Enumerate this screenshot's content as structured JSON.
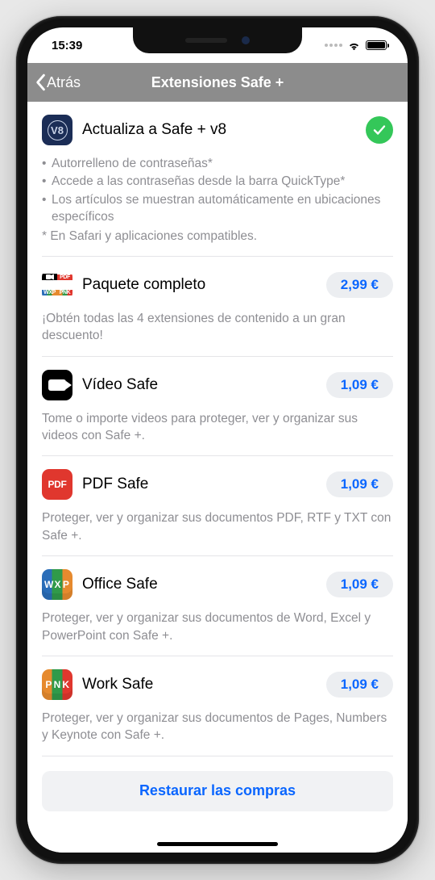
{
  "status": {
    "time": "15:39"
  },
  "nav": {
    "back": "Atrás",
    "title": "Extensiones Safe +"
  },
  "upgrade": {
    "title": "Actualiza a Safe + v8",
    "bullets": [
      "Autorrelleno de contraseñas*",
      "Accede a las contraseñas desde la barra QuickType*",
      "Los artículos se muestran automáticamente en ubicaciones específicos"
    ],
    "footnote": "* En Safari y aplicaciones compatibles."
  },
  "items": [
    {
      "title": "Paquete completo",
      "price": "2,99 €",
      "desc": "¡Obtén todas las 4 extensiones de contenido a un gran descuento!"
    },
    {
      "title": "Vídeo Safe",
      "price": "1,09 €",
      "desc": "Tome o importe videos para proteger, ver y organizar sus videos con Safe +."
    },
    {
      "title": "PDF Safe",
      "price": "1,09 €",
      "desc": "Proteger, ver y organizar sus documentos PDF, RTF y TXT con Safe +."
    },
    {
      "title": "Office Safe",
      "price": "1,09 €",
      "desc": "Proteger, ver y organizar sus documentos de Word, Excel y PowerPoint con Safe +."
    },
    {
      "title": "Work Safe",
      "price": "1,09 €",
      "desc": "Proteger, ver y organizar sus documentos de Pages, Numbers y Keynote con Safe +."
    }
  ],
  "restore": "Restaurar las compras"
}
